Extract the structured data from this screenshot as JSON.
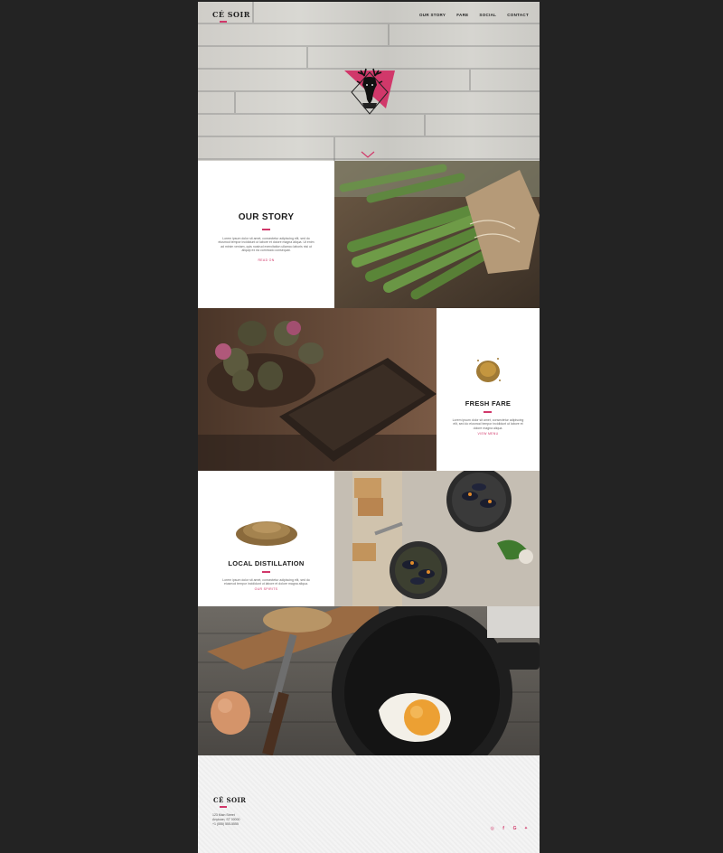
{
  "brand": {
    "logo_text": "CÉ SOIR",
    "accent_color": "#d1386a"
  },
  "nav": {
    "items": [
      "OUR STORY",
      "FARE",
      "SOCIAL",
      "CONTACT"
    ]
  },
  "sections": {
    "story": {
      "title": "OUR STORY",
      "body": "Lorem ipsum dolor sit amet, consectetur adipiscing elit, sed do eiusmod tempor incididunt ut labore et dolore magna aliqua. Ut enim ad minim veniam, quis nostrud exercitation ullamco laboris nisi ut aliquip ex ea commodo consequat.",
      "more": "READ ON"
    },
    "fare": {
      "title": "FRESH FARE",
      "body": "Lorem ipsum dolor sit amet, consectetur adipiscing elit, sed do eiusmod tempor incididunt ut labore et dolore magna aliqua.",
      "more": "VIEW MENU"
    },
    "distillation": {
      "title": "LOCAL DISTILLATION",
      "body": "Lorem ipsum dolor sit amet, consectetur adipiscing elit, sed do eiusmod tempor incididunt ut labore et dolore magna aliqua.",
      "more": "OUR SPIRITS"
    }
  },
  "footer": {
    "logo_text": "CÉ SOIR",
    "address_lines": [
      "123 Main Street",
      "Anytown, ST 00000",
      "+1 (555) 555-5555"
    ],
    "social_icons": [
      "instagram-icon",
      "facebook-icon",
      "google-plus-icon",
      "twitter-icon"
    ]
  }
}
